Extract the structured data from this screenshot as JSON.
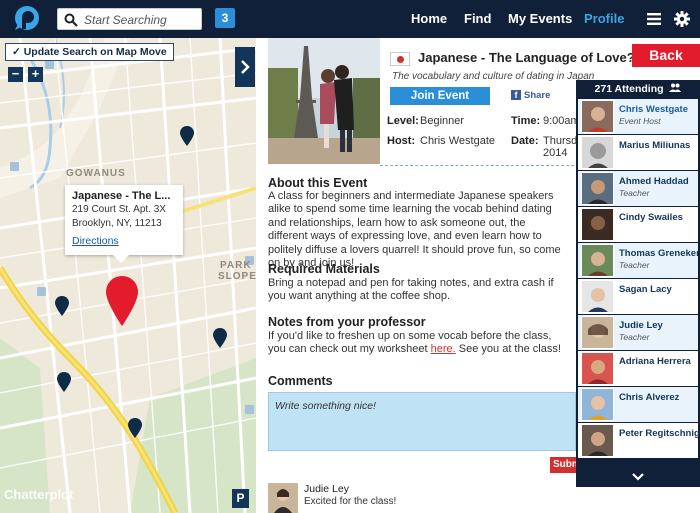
{
  "topbar": {
    "search_placeholder": "Start Searching",
    "result_count": "3",
    "nav": [
      {
        "label": "Home"
      },
      {
        "label": "Find"
      },
      {
        "label": "My Events"
      },
      {
        "label": "Profile"
      }
    ],
    "colors": {
      "bar": "#0f2038",
      "accent": "#3aa6e8"
    }
  },
  "map": {
    "update_button": "✓ Update Search on Map Move",
    "zoom_out": "−",
    "zoom_in": "+",
    "labels": {
      "gowanus": "GOWANUS",
      "park": "PARK",
      "slope": "SLOPE"
    },
    "popup": {
      "title": "Japanese - The L...",
      "address_line1": "219 Court St. Apt. 3X",
      "address_line2": "Brooklyn, NY, 11213",
      "directions": "Directions"
    },
    "watermark": "Chatterplot",
    "pinterest": "P"
  },
  "event": {
    "title": "Japanese - The Language of Love???",
    "subtitle": "The vocabulary and culture of dating in Japan",
    "join_label": "Join Event",
    "share_label": "Share",
    "level_label": "Level:",
    "level_value": "Beginner",
    "host_label": "Host:",
    "host_value": "Chris Westgate",
    "time_label": "Time:",
    "time_value": "9:00am",
    "date_label": "Date:",
    "date_value_line1": "Thursday",
    "date_value_line2": "2014",
    "back_label": "Back"
  },
  "about": {
    "heading": "About this Event",
    "text": "A class for beginners and intermediate Japanese speakers alike to spend some time learning the vocab behind dating and relationships, learn how to ask someone out, the different ways of expressing love, and even learn how to politely diffuse a lovers quarrel! It should prove fun, so come on by and join us!"
  },
  "materials": {
    "heading": "Required Materials",
    "text": "Bring a notepad and pen for taking notes, and extra cash if you want anything at the coffee shop."
  },
  "notes": {
    "heading": "Notes from your professor",
    "text_before": "If you'd like to freshen up on some vocab before the class, you can check out my worksheet",
    "link": "here.",
    "text_after": "See you at the class!"
  },
  "comments": {
    "heading": "Comments",
    "placeholder": "Write something nice!",
    "submit_label": "Submit",
    "items": [
      {
        "name": "Judie Ley",
        "text": "Excited for the class!"
      }
    ]
  },
  "attendees": {
    "header": "271 Attending",
    "people": [
      {
        "name": "Chris Westgate",
        "role": "Event Host"
      },
      {
        "name": "Marius Miliunas",
        "role": ""
      },
      {
        "name": "Ahmed Haddad",
        "role": "Teacher"
      },
      {
        "name": "Cindy Swailes",
        "role": ""
      },
      {
        "name": "Thomas Greneker",
        "role": "Teacher"
      },
      {
        "name": "Sagan Lacy",
        "role": ""
      },
      {
        "name": "Judie Ley",
        "role": "Teacher"
      },
      {
        "name": "Adriana Herrera",
        "role": ""
      },
      {
        "name": "Chris Alverez",
        "role": ""
      },
      {
        "name": "Peter Regitschnig",
        "role": ""
      }
    ]
  }
}
